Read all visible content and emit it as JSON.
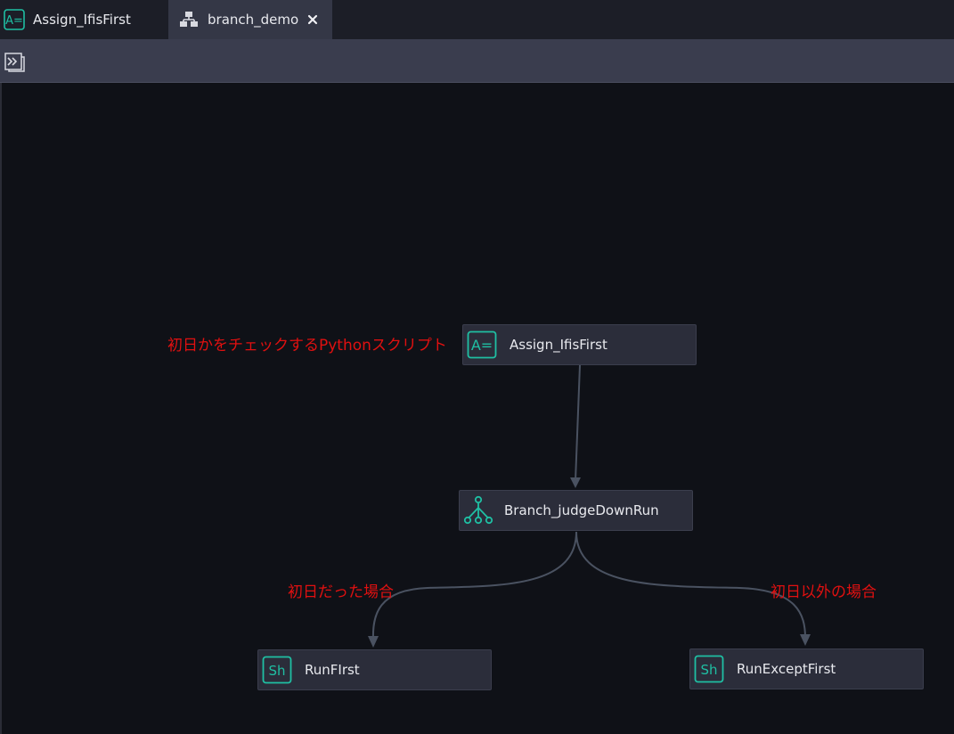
{
  "tabs": [
    {
      "label": "Assign_IfisFirst",
      "icon": "assign-icon",
      "active": false
    },
    {
      "label": "branch_demo",
      "icon": "workflow-icon",
      "active": true,
      "closable": true
    }
  ],
  "toolbar": {
    "expand_icon": "expand-panel-icon"
  },
  "nodes": {
    "assign": {
      "label": "Assign_IfisFirst",
      "icon": "assign-icon",
      "icon_text": "A="
    },
    "branch": {
      "label": "Branch_judgeDownRun",
      "icon": "branch-icon"
    },
    "run_first": {
      "label": "RunFIrst",
      "icon": "shell-icon",
      "icon_text": "Sh"
    },
    "run_except": {
      "label": "RunExceptFirst",
      "icon": "shell-icon",
      "icon_text": "Sh"
    }
  },
  "annotations": {
    "assign_note": "初日かをチェックするPythonスクリプト",
    "first_day": "初日だった場合",
    "not_first_day": "初日以外の場合"
  },
  "colors": {
    "accent": "#1fbfa3",
    "annotation": "#e01010",
    "edge": "#4a5261",
    "node_bg": "#2b2d3a",
    "canvas_bg": "#0f1117"
  }
}
